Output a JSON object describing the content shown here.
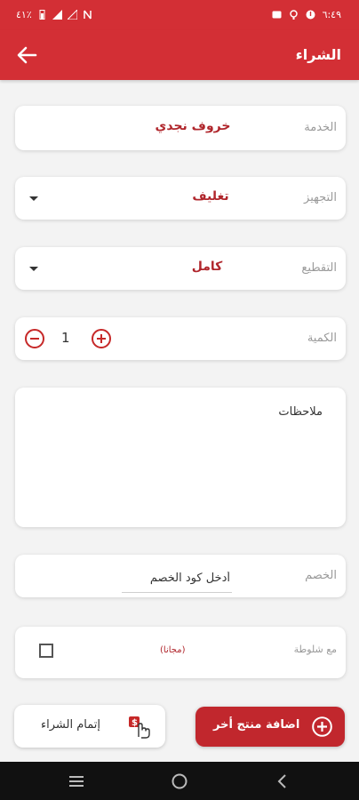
{
  "status_bar": {
    "time": "٦:٤٩",
    "battery": "٤١٪"
  },
  "header": {
    "title": "الشراء",
    "back_icon": "arrow-left-icon"
  },
  "form": {
    "service": {
      "label": "الخدمة",
      "value": "خروف نجدي"
    },
    "preparation": {
      "label": "التجهيز",
      "value": "تغليف"
    },
    "cutting": {
      "label": "التقطيع",
      "value": "كامل"
    },
    "quantity": {
      "label": "الكمية",
      "value": "1"
    },
    "notes": {
      "label": "ملاحظات"
    },
    "discount": {
      "label": "الخصم",
      "placeholder": "أدخل كود الخصم"
    },
    "tripe": {
      "label": "مع شلوطة",
      "note": "(مجانا)",
      "checked": false
    }
  },
  "actions": {
    "complete_label": "إتمام الشراء",
    "add_label": "اضافة منتج أخر"
  },
  "colors": {
    "primary": "#d32f35",
    "accent_text": "#b0262c"
  }
}
